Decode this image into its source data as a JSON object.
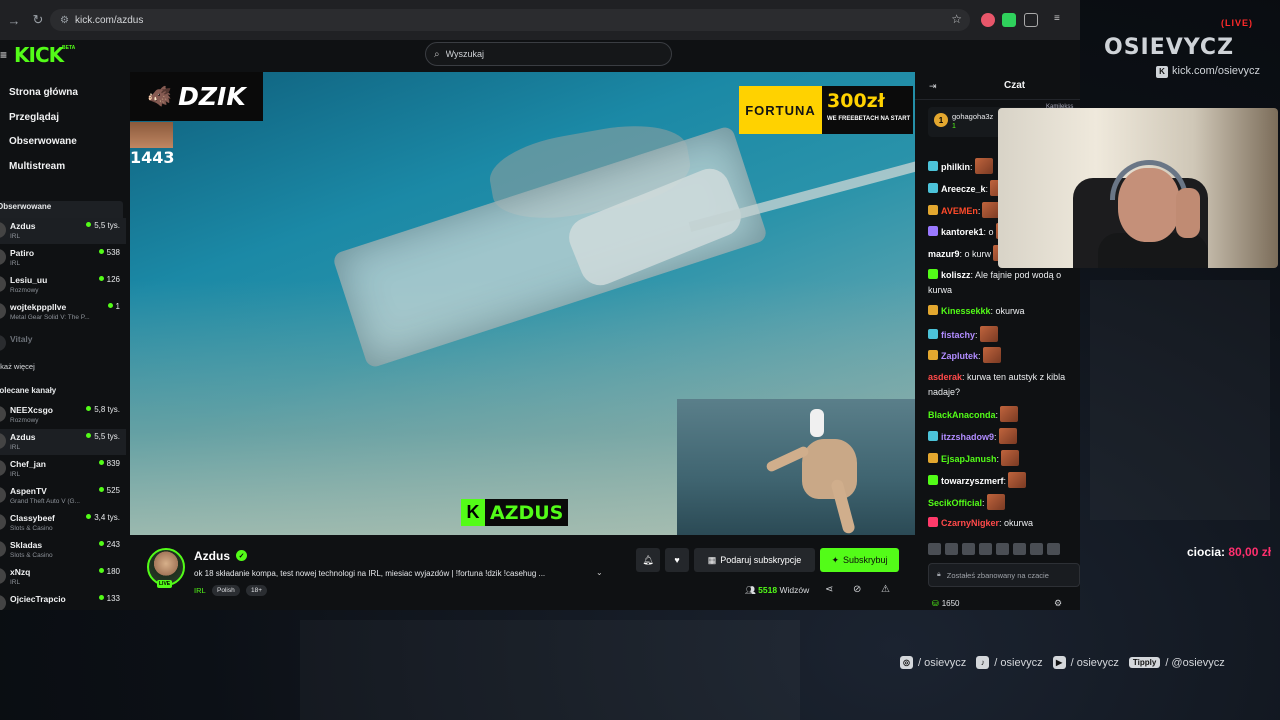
{
  "browser": {
    "url": "kick.com/azdus"
  },
  "header": {
    "logo": "KICK",
    "beta": "BETA",
    "search_placeholder": "Wyszukaj"
  },
  "sidebar": {
    "nav": [
      "Strona główna",
      "Przeglądaj",
      "Obserwowane",
      "Multistream"
    ],
    "followed_title": "Obserwowane",
    "followed": [
      {
        "name": "Azdus",
        "category": "IRL",
        "viewers": "5,5 tys."
      },
      {
        "name": "Patiro",
        "category": "IRL",
        "viewers": "538"
      },
      {
        "name": "Lesiu_uu",
        "category": "Rozmowy",
        "viewers": "126"
      },
      {
        "name": "wojtekpppllve",
        "category": "Metal Gear Solid V: The P...",
        "viewers": "1"
      },
      {
        "name": "Vitaly",
        "category": "",
        "viewers": ""
      }
    ],
    "show_more": "Pokaż więcej",
    "recommended_title": "Polecane kanały",
    "recommended": [
      {
        "name": "NEEXcsgo",
        "category": "Rozmowy",
        "viewers": "5,8 tys."
      },
      {
        "name": "Azdus",
        "category": "IRL",
        "viewers": "5,5 tys."
      },
      {
        "name": "Chef_jan",
        "category": "IRL",
        "viewers": "839"
      },
      {
        "name": "AspenTV",
        "category": "Grand Theft Auto V (G...",
        "viewers": "525"
      },
      {
        "name": "Classybeef",
        "category": "Slots & Casino",
        "viewers": "3,4 tys."
      },
      {
        "name": "Skladas",
        "category": "Slots & Casino",
        "viewers": "243"
      },
      {
        "name": "xNzq",
        "category": "IRL",
        "viewers": "180"
      },
      {
        "name": "OjciecTrapcio",
        "category": "",
        "viewers": "133"
      }
    ]
  },
  "video": {
    "sponsor_left": "DZIK",
    "side_number": "1443",
    "sponsor_right": "FORTUNA",
    "sponsor_amount": "300zł",
    "sponsor_sub": "WE FREEBETACH NA START",
    "name_tag_k": "K",
    "name_tag": "AZDUS"
  },
  "stream": {
    "streamer": "Azdus",
    "live_badge": "LIVE",
    "title": "ok 18 składanie kompa, test nowej technologi na IRL, miesiac wyjazdów | !fortuna !dzik !casehug ...",
    "category": "IRL",
    "tags": [
      "Polish",
      "18+"
    ],
    "gift_sub_label": "Podaruj subskrypcje",
    "subscribe_label": "Subskrybuj",
    "viewers_count": "5518",
    "viewers_label": "Widzów"
  },
  "chat": {
    "title": "Czat",
    "pinned_user": "gohagoha3z",
    "pinned_rank": "1",
    "pinned_count": "1",
    "pinned_other": "Kamilekss",
    "messages": [
      {
        "user": "philkin",
        "color": "#ffffff",
        "badge": "#4cc3d9",
        "text": ":"
      },
      {
        "user": "Areecze_k",
        "color": "#ffffff",
        "badge": "#4cc3d9",
        "text": ":"
      },
      {
        "user": "AVEMEn",
        "color": "#ff4a2a",
        "badge": "#e3a72f",
        "text": ":"
      },
      {
        "user": "kantorek1",
        "color": "#ffffff",
        "badge": "#9a79ff",
        "text": ": o"
      },
      {
        "user": "mazur9",
        "color": "#ffffff",
        "badge": "",
        "text": ": o kurw"
      },
      {
        "user": "koliszz",
        "color": "#ffffff",
        "badge": "#53fc18",
        "text": ": Ale fajnie pod wodą o kurwa"
      },
      {
        "user": "Kinessekkk",
        "color": "#53fc18",
        "badge": "#e3a72f",
        "text": ": okurwa"
      },
      {
        "user": "fistachy",
        "color": "#b18cff",
        "badge": "#4cc3d9",
        "text": ":"
      },
      {
        "user": "Zaplutek",
        "color": "#b18cff",
        "badge": "#e3a72f",
        "text": ":"
      },
      {
        "user": "asderak",
        "color": "#ff4a4a",
        "badge": "",
        "text": ": kurwa ten autstyk z kibla nadaje?"
      },
      {
        "user": "BlackAnaconda",
        "color": "#53fc18",
        "badge": "",
        "text": ":"
      },
      {
        "user": "itzzshadow9",
        "color": "#b18cff",
        "badge": "#4cc3d9",
        "text": ":"
      },
      {
        "user": "EjsapJanush",
        "color": "#53fc18",
        "badge": "#e3a72f",
        "text": ":"
      },
      {
        "user": "towarzyszmerf",
        "color": "#ffffff",
        "badge": "#53fc18",
        "text": ":"
      },
      {
        "user": "SecikOfficial",
        "color": "#53fc18",
        "badge": "",
        "text": ":"
      },
      {
        "user": "CzarnyNigker",
        "color": "#ff4a4a",
        "badge": "#ff3a6a",
        "text": ": okurwa"
      }
    ],
    "input_placeholder": "Zostałeś zbanowany na czacie",
    "points": "1650"
  },
  "overlay": {
    "brand": "OSIEVYCZ",
    "live": "LIVE",
    "kick_url": "kick.com/osievycz",
    "donation_user": "ciocia:",
    "donation_amount": "80,00 zł",
    "socials": [
      {
        "icon": "instagram-icon",
        "glyph": "◎",
        "handle": "/ osievycz"
      },
      {
        "icon": "tiktok-icon",
        "glyph": "♪",
        "handle": "/ osievycz"
      },
      {
        "icon": "youtube-icon",
        "glyph": "▶",
        "handle": "/ osievycz"
      }
    ],
    "tipply_label": "Tipply",
    "tipply_handle": "/ @osievycz"
  }
}
